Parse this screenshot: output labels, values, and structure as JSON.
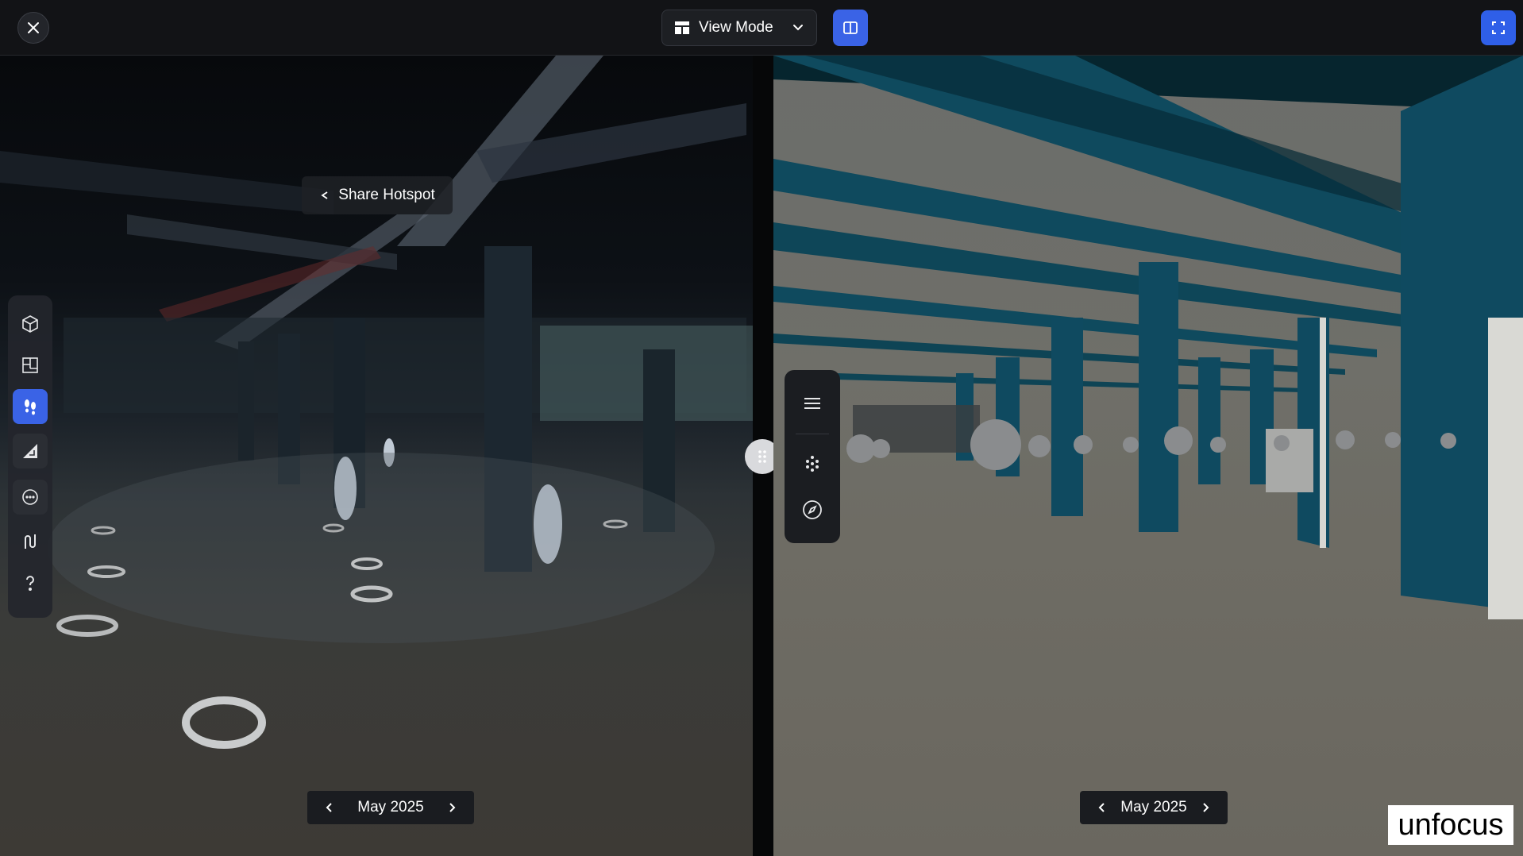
{
  "topbar": {
    "view_mode_label": "View Mode",
    "icons": {
      "close": "close-icon",
      "layout": "layout-grid-icon",
      "chevron": "chevron-down-icon",
      "split": "split-view-icon",
      "fullscreen": "fullscreen-icon"
    },
    "accent_color": "#3a63e6"
  },
  "left_view": {
    "share_label": "Share Hotspot",
    "date_label": "May 2025",
    "tools": [
      {
        "icon": "cube-3d-icon",
        "active": false
      },
      {
        "icon": "floorplan-icon",
        "active": false
      },
      {
        "icon": "footsteps-icon",
        "active": true
      },
      {
        "icon": "measure-ruler-icon",
        "active": false
      },
      {
        "icon": "comment-icon",
        "active": false
      },
      {
        "icon": "route-path-icon",
        "active": false
      },
      {
        "icon": "help-question-icon",
        "active": false
      }
    ]
  },
  "right_view": {
    "date_label": "May 2025",
    "menu": [
      {
        "icon": "hamburger-menu-icon"
      },
      {
        "icon": "point-cloud-icon"
      },
      {
        "icon": "compass-icon"
      }
    ]
  },
  "overlay": {
    "unfocus_label": "unfocus"
  }
}
